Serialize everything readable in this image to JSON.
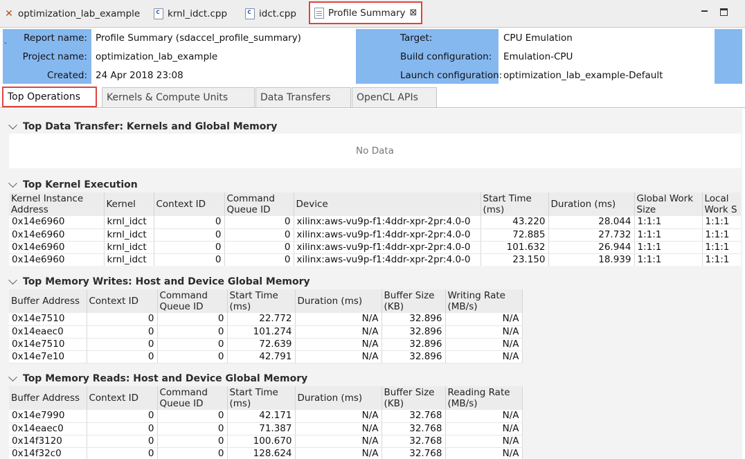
{
  "editor_tabs": [
    {
      "label": "optimization_lab_example"
    },
    {
      "label": "krnl_idct.cpp"
    },
    {
      "label": "idct.cpp"
    },
    {
      "label": "Profile Summary"
    }
  ],
  "close_glyph": "⊠",
  "header": {
    "collapse_glyph": "-",
    "left": [
      {
        "label": "Report name:",
        "value": "Profile Summary (sdaccel_profile_summary)"
      },
      {
        "label": "Project name:",
        "value": "optimization_lab_example"
      },
      {
        "label": "Created:",
        "value": "24 Apr 2018 23:08"
      }
    ],
    "right": [
      {
        "label": "Target:",
        "value": "CPU Emulation"
      },
      {
        "label": "Build configuration:",
        "value": "Emulation-CPU"
      },
      {
        "label": "Launch configuration:",
        "value": "optimization_lab_example-Default"
      }
    ]
  },
  "report_tabs": [
    {
      "label": "Top Operations"
    },
    {
      "label": "Kernels & Compute Units"
    },
    {
      "label": "Data Transfers"
    },
    {
      "label": "OpenCL APIs"
    }
  ],
  "sections": {
    "data_transfer": {
      "title": "Top Data Transfer: Kernels and Global Memory",
      "empty_text": "No Data"
    },
    "kernel_exec": {
      "title": "Top Kernel Execution",
      "columns": [
        "Kernel Instance Address",
        "Kernel",
        "Context ID",
        "Command Queue ID",
        "Device",
        "Start Time (ms)",
        "Duration (ms)",
        "Global Work Size",
        "Local Work S"
      ],
      "rows": [
        [
          "0x14e6960",
          "krnl_idct",
          "0",
          "0",
          "xilinx:aws-vu9p-f1:4ddr-xpr-2pr:4.0-0",
          "43.220",
          "28.044",
          "1:1:1",
          "1:1:1"
        ],
        [
          "0x14e6960",
          "krnl_idct",
          "0",
          "0",
          "xilinx:aws-vu9p-f1:4ddr-xpr-2pr:4.0-0",
          "72.885",
          "27.732",
          "1:1:1",
          "1:1:1"
        ],
        [
          "0x14e6960",
          "krnl_idct",
          "0",
          "0",
          "xilinx:aws-vu9p-f1:4ddr-xpr-2pr:4.0-0",
          "101.632",
          "26.944",
          "1:1:1",
          "1:1:1"
        ],
        [
          "0x14e6960",
          "krnl_idct",
          "0",
          "0",
          "xilinx:aws-vu9p-f1:4ddr-xpr-2pr:4.0-0",
          "23.150",
          "18.939",
          "1:1:1",
          "1:1:1"
        ]
      ]
    },
    "mem_writes": {
      "title": "Top Memory Writes: Host and Device Global Memory",
      "columns": [
        "Buffer Address",
        "Context ID",
        "Command Queue ID",
        "Start Time (ms)",
        "Duration (ms)",
        "Buffer Size (KB)",
        "Writing Rate (MB/s)"
      ],
      "rows": [
        [
          "0x14e7510",
          "0",
          "0",
          "22.772",
          "N/A",
          "32.896",
          "N/A"
        ],
        [
          "0x14eaec0",
          "0",
          "0",
          "101.274",
          "N/A",
          "32.896",
          "N/A"
        ],
        [
          "0x14e7510",
          "0",
          "0",
          "72.639",
          "N/A",
          "32.896",
          "N/A"
        ],
        [
          "0x14e7e10",
          "0",
          "0",
          "42.791",
          "N/A",
          "32.896",
          "N/A"
        ]
      ]
    },
    "mem_reads": {
      "title": "Top Memory Reads: Host and Device Global Memory",
      "columns": [
        "Buffer Address",
        "Context ID",
        "Command Queue ID",
        "Start Time (ms)",
        "Duration (ms)",
        "Buffer Size (KB)",
        "Reading Rate (MB/s)"
      ],
      "rows": [
        [
          "0x14e7990",
          "0",
          "0",
          "42.171",
          "N/A",
          "32.768",
          "N/A"
        ],
        [
          "0x14eaec0",
          "0",
          "0",
          "71.387",
          "N/A",
          "32.768",
          "N/A"
        ],
        [
          "0x14f3120",
          "0",
          "0",
          "100.670",
          "N/A",
          "32.768",
          "N/A"
        ],
        [
          "0x14f32c0",
          "0",
          "0",
          "128.624",
          "N/A",
          "32.768",
          "N/A"
        ]
      ]
    }
  }
}
